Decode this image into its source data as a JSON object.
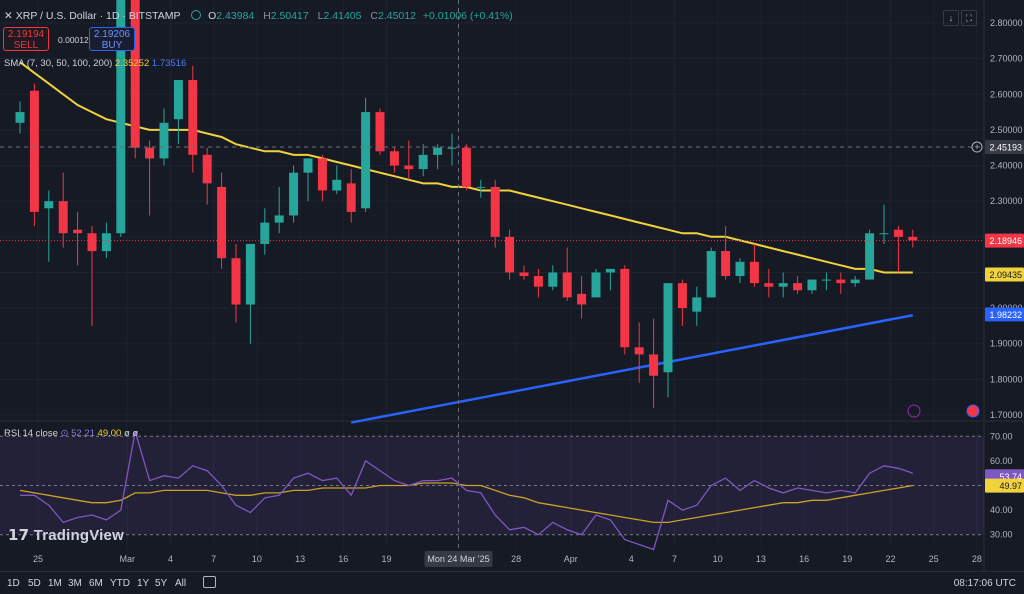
{
  "header": {
    "symbol": "XRP / U.S. Dollar · 1D · BITSTAMP",
    "o_label": "O",
    "o": "2.43984",
    "h_label": "H",
    "h": "2.50417",
    "l_label": "L",
    "l": "2.41405",
    "c_label": "C",
    "c": "2.45012",
    "change": "+0.01006 (+0.41%)"
  },
  "trade": {
    "sell_price": "2.19194",
    "sell_label": "SELL",
    "spread": "0.00012",
    "buy_price": "2.19206",
    "buy_label": "BUY"
  },
  "sma_legend": {
    "name": "SMA (7, 30, 50, 100, 200)",
    "v1": "2.35252",
    "v2": "1.73516"
  },
  "rsi_legend": {
    "name": "RSI 14 close",
    "v1": "52.21",
    "v2": "49.00",
    "v3": "ø ø"
  },
  "logo": "TradingView",
  "timeframes": [
    "1D",
    "5D",
    "1M",
    "3M",
    "6M",
    "YTD",
    "1Y",
    "5Y",
    "All"
  ],
  "clock": "08:17:06 UTC",
  "colors": {
    "bg": "#161a25",
    "up": "#26a69a",
    "down": "#f23645",
    "sma_fast": "#f0d23c",
    "sma_slow": "#2962ff",
    "rsi": "#7e57c2",
    "rsi_ma": "#c9a227"
  },
  "chart_data": [
    {
      "type": "candlestick",
      "yaxis_ticks": [
        "2.80000",
        "2.70000",
        "2.60000",
        "2.50000",
        "2.40000",
        "2.30000",
        "2.20000",
        "2.10000",
        "2.00000",
        "1.90000",
        "1.80000",
        "1.70000"
      ],
      "ylim": [
        1.68,
        2.83
      ],
      "xaxis_ticks": [
        "25",
        "Mar",
        "4",
        "7",
        "10",
        "13",
        "16",
        "19",
        "Mon 24 Mar '25",
        "28",
        "Apr",
        "4",
        "7",
        "10",
        "13",
        "16",
        "19",
        "22",
        "25",
        "28"
      ],
      "price_labels": {
        "crosshair": "2.45193",
        "last": "2.18946",
        "sma_fast": "2.09435",
        "sma_slow": "1.98232"
      },
      "candles": [
        {
          "o": 2.52,
          "h": 2.58,
          "l": 2.49,
          "c": 2.55
        },
        {
          "o": 2.61,
          "h": 2.63,
          "l": 2.23,
          "c": 2.27
        },
        {
          "o": 2.28,
          "h": 2.33,
          "l": 2.13,
          "c": 2.3
        },
        {
          "o": 2.3,
          "h": 2.38,
          "l": 2.17,
          "c": 2.21
        },
        {
          "o": 2.22,
          "h": 2.27,
          "l": 2.12,
          "c": 2.21
        },
        {
          "o": 2.21,
          "h": 2.23,
          "l": 1.95,
          "c": 2.16
        },
        {
          "o": 2.16,
          "h": 2.24,
          "l": 2.14,
          "c": 2.21
        },
        {
          "o": 2.21,
          "h": 2.85,
          "l": 2.2,
          "c": 2.88
        },
        {
          "o": 2.93,
          "h": 2.95,
          "l": 2.42,
          "c": 2.45
        },
        {
          "o": 2.45,
          "h": 2.47,
          "l": 2.26,
          "c": 2.42
        },
        {
          "o": 2.42,
          "h": 2.56,
          "l": 2.4,
          "c": 2.52
        },
        {
          "o": 2.53,
          "h": 2.62,
          "l": 2.46,
          "c": 2.64
        },
        {
          "o": 2.64,
          "h": 2.68,
          "l": 2.38,
          "c": 2.43
        },
        {
          "o": 2.43,
          "h": 2.45,
          "l": 2.29,
          "c": 2.35
        },
        {
          "o": 2.34,
          "h": 2.38,
          "l": 2.11,
          "c": 2.14
        },
        {
          "o": 2.14,
          "h": 2.18,
          "l": 1.96,
          "c": 2.01
        },
        {
          "o": 2.01,
          "h": 2.18,
          "l": 1.9,
          "c": 2.18
        },
        {
          "o": 2.18,
          "h": 2.28,
          "l": 2.15,
          "c": 2.24
        },
        {
          "o": 2.24,
          "h": 2.34,
          "l": 2.21,
          "c": 2.26
        },
        {
          "o": 2.26,
          "h": 2.4,
          "l": 2.24,
          "c": 2.38
        },
        {
          "o": 2.38,
          "h": 2.42,
          "l": 2.3,
          "c": 2.42
        },
        {
          "o": 2.42,
          "h": 2.43,
          "l": 2.3,
          "c": 2.33
        },
        {
          "o": 2.33,
          "h": 2.4,
          "l": 2.32,
          "c": 2.36
        },
        {
          "o": 2.35,
          "h": 2.39,
          "l": 2.24,
          "c": 2.27
        },
        {
          "o": 2.28,
          "h": 2.59,
          "l": 2.27,
          "c": 2.55
        },
        {
          "o": 2.55,
          "h": 2.56,
          "l": 2.43,
          "c": 2.44
        },
        {
          "o": 2.44,
          "h": 2.45,
          "l": 2.38,
          "c": 2.4
        },
        {
          "o": 2.4,
          "h": 2.47,
          "l": 2.36,
          "c": 2.39
        },
        {
          "o": 2.39,
          "h": 2.46,
          "l": 2.37,
          "c": 2.43
        },
        {
          "o": 2.43,
          "h": 2.46,
          "l": 2.39,
          "c": 2.45
        },
        {
          "o": 2.45,
          "h": 2.49,
          "l": 2.4,
          "c": 2.45
        },
        {
          "o": 2.45,
          "h": 2.46,
          "l": 2.33,
          "c": 2.34
        },
        {
          "o": 2.34,
          "h": 2.36,
          "l": 2.31,
          "c": 2.34
        },
        {
          "o": 2.34,
          "h": 2.36,
          "l": 2.17,
          "c": 2.2
        },
        {
          "o": 2.2,
          "h": 2.22,
          "l": 2.08,
          "c": 2.1
        },
        {
          "o": 2.1,
          "h": 2.12,
          "l": 2.08,
          "c": 2.09
        },
        {
          "o": 2.09,
          "h": 2.11,
          "l": 2.03,
          "c": 2.06
        },
        {
          "o": 2.06,
          "h": 2.12,
          "l": 2.05,
          "c": 2.1
        },
        {
          "o": 2.1,
          "h": 2.17,
          "l": 2.02,
          "c": 2.03
        },
        {
          "o": 2.04,
          "h": 2.09,
          "l": 1.97,
          "c": 2.01
        },
        {
          "o": 2.03,
          "h": 2.11,
          "l": 2.03,
          "c": 2.1
        },
        {
          "o": 2.1,
          "h": 2.11,
          "l": 2.05,
          "c": 2.11
        },
        {
          "o": 2.11,
          "h": 2.12,
          "l": 1.87,
          "c": 1.89
        },
        {
          "o": 1.89,
          "h": 1.96,
          "l": 1.79,
          "c": 1.87
        },
        {
          "o": 1.87,
          "h": 1.97,
          "l": 1.72,
          "c": 1.81
        },
        {
          "o": 1.82,
          "h": 2.06,
          "l": 1.75,
          "c": 2.07
        },
        {
          "o": 2.07,
          "h": 2.08,
          "l": 1.95,
          "c": 2.0
        },
        {
          "o": 1.99,
          "h": 2.06,
          "l": 1.95,
          "c": 2.03
        },
        {
          "o": 2.03,
          "h": 2.17,
          "l": 2.03,
          "c": 2.16
        },
        {
          "o": 2.16,
          "h": 2.23,
          "l": 2.08,
          "c": 2.09
        },
        {
          "o": 2.09,
          "h": 2.14,
          "l": 2.07,
          "c": 2.13
        },
        {
          "o": 2.13,
          "h": 2.18,
          "l": 2.06,
          "c": 2.07
        },
        {
          "o": 2.07,
          "h": 2.11,
          "l": 2.03,
          "c": 2.06
        },
        {
          "o": 2.06,
          "h": 2.1,
          "l": 2.03,
          "c": 2.07
        },
        {
          "o": 2.07,
          "h": 2.09,
          "l": 2.04,
          "c": 2.05
        },
        {
          "o": 2.05,
          "h": 2.08,
          "l": 2.04,
          "c": 2.08
        },
        {
          "o": 2.08,
          "h": 2.1,
          "l": 2.05,
          "c": 2.08
        },
        {
          "o": 2.08,
          "h": 2.1,
          "l": 2.04,
          "c": 2.07
        },
        {
          "o": 2.07,
          "h": 2.09,
          "l": 2.06,
          "c": 2.08
        },
        {
          "o": 2.08,
          "h": 2.22,
          "l": 2.08,
          "c": 2.21
        },
        {
          "o": 2.21,
          "h": 2.29,
          "l": 2.18,
          "c": 2.21
        },
        {
          "o": 2.22,
          "h": 2.23,
          "l": 2.1,
          "c": 2.2
        },
        {
          "o": 2.2,
          "h": 2.22,
          "l": 2.17,
          "c": 2.19
        }
      ],
      "sma_fast": [
        2.69,
        2.66,
        2.63,
        2.6,
        2.57,
        2.55,
        2.53,
        2.52,
        2.51,
        2.5,
        2.5,
        2.5,
        2.5,
        2.49,
        2.48,
        2.46,
        2.45,
        2.44,
        2.44,
        2.43,
        2.43,
        2.42,
        2.41,
        2.4,
        2.39,
        2.38,
        2.37,
        2.36,
        2.35,
        2.35,
        2.34,
        2.34,
        2.33,
        2.33,
        2.33,
        2.32,
        2.31,
        2.3,
        2.29,
        2.28,
        2.27,
        2.26,
        2.25,
        2.24,
        2.23,
        2.22,
        2.21,
        2.21,
        2.2,
        2.2,
        2.19,
        2.18,
        2.17,
        2.16,
        2.15,
        2.14,
        2.13,
        2.12,
        2.11,
        2.11,
        2.1,
        2.1,
        2.1
      ],
      "sma_slow": {
        "start_index": 23,
        "start_value": 1.69,
        "end_value": 1.98
      }
    },
    {
      "type": "line",
      "name": "RSI 14 close",
      "yaxis_ticks": [
        "70.00",
        "60.00",
        "50.00",
        "40.00",
        "30.00"
      ],
      "ylim": [
        25,
        75
      ],
      "labels": {
        "rsi": "53.74",
        "ma": "49.97"
      },
      "rsi": [
        46,
        46,
        42,
        35,
        37,
        38,
        36,
        40,
        72,
        52,
        54,
        53,
        58,
        56,
        50,
        42,
        39,
        45,
        46,
        53,
        55,
        52,
        53,
        46,
        60,
        56,
        52,
        50,
        52,
        52,
        53,
        48,
        47,
        38,
        32,
        33,
        30,
        35,
        32,
        30,
        38,
        36,
        28,
        26,
        24,
        44,
        40,
        42,
        50,
        53,
        48,
        52,
        49,
        47,
        49,
        48,
        47,
        48,
        47,
        55,
        58,
        57,
        55
      ],
      "rsi_ma": [
        48,
        47,
        46,
        45,
        44,
        43,
        43,
        44,
        47,
        47,
        48,
        48,
        48,
        48,
        47,
        46,
        46,
        47,
        47,
        48,
        48,
        49,
        49,
        49,
        49,
        50,
        50,
        50,
        51,
        51,
        51,
        50,
        50,
        48,
        46,
        45,
        43,
        42,
        41,
        40,
        39,
        38,
        37,
        36,
        35,
        35,
        36,
        37,
        38,
        39,
        40,
        41,
        42,
        43,
        43,
        44,
        44,
        45,
        46,
        47,
        48,
        49,
        50
      ]
    }
  ]
}
